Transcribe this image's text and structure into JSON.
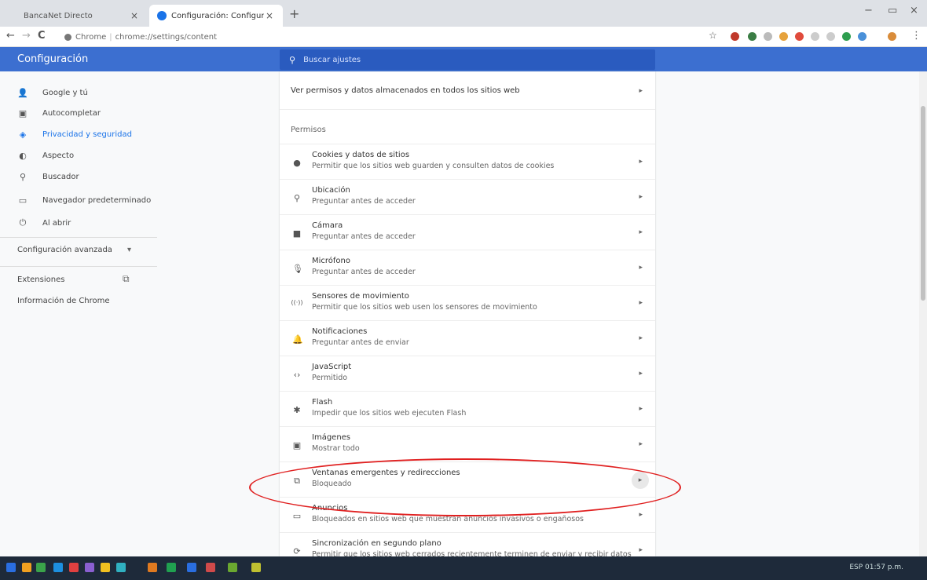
{
  "tabs": [
    {
      "title": "BancaNet Directo",
      "close": "×"
    },
    {
      "title": "Configuración: Configuración de",
      "close": "×"
    }
  ],
  "new_tab": "+",
  "window_controls": {
    "minimize": "−",
    "restore": "▭",
    "close": "×"
  },
  "address_bar": {
    "back": "←",
    "forward": "→",
    "reload": "C",
    "site_label": "Chrome",
    "separator": "|",
    "url": "chrome://settings/content",
    "bookmark_star": "☆",
    "menu": "⋮"
  },
  "header": {
    "title": "Configuración",
    "search_placeholder": "Buscar ajustes",
    "search_icon": "search-icon"
  },
  "sidebar": {
    "items": [
      {
        "label": "Google y tú",
        "icon": "person-icon",
        "glyph": "👤"
      },
      {
        "label": "Autocompletar",
        "icon": "clipboard-icon",
        "glyph": "▣"
      },
      {
        "label": "Privacidad y seguridad",
        "icon": "shield-icon",
        "glyph": "◈",
        "active": true
      },
      {
        "label": "Aspecto",
        "icon": "palette-icon",
        "glyph": "◐"
      },
      {
        "label": "Buscador",
        "icon": "search-icon",
        "glyph": "⚲"
      },
      {
        "label": "Navegador predeterminado",
        "icon": "browser-icon",
        "glyph": "▭"
      },
      {
        "label": "Al abrir",
        "icon": "power-icon",
        "glyph": "⏻"
      }
    ],
    "advanced": "Configuración avanzada",
    "advanced_chevron": "▾",
    "extensions": "Extensiones",
    "extensions_icon": "⧉",
    "about": "Información de Chrome"
  },
  "content": {
    "top_row": "Ver permisos y datos almacenados en todos los sitios web",
    "section": "Permisos",
    "arrow": "▸",
    "rows": [
      {
        "icon": "cookie-icon",
        "glyph": "●",
        "primary": "Cookies y datos de sitios",
        "secondary": "Permitir que los sitios web guarden y consulten datos de cookies"
      },
      {
        "icon": "location-icon",
        "glyph": "⚲",
        "primary": "Ubicación",
        "secondary": "Preguntar antes de acceder"
      },
      {
        "icon": "camera-icon",
        "glyph": "■",
        "primary": "Cámara",
        "secondary": "Preguntar antes de acceder"
      },
      {
        "icon": "microphone-icon",
        "glyph": "🎙",
        "primary": "Micrófono",
        "secondary": "Preguntar antes de acceder"
      },
      {
        "icon": "motion-sensor-icon",
        "glyph": "((·))",
        "primary": "Sensores de movimiento",
        "secondary": "Permitir que los sitios web usen los sensores de movimiento"
      },
      {
        "icon": "bell-icon",
        "glyph": "🔔",
        "primary": "Notificaciones",
        "secondary": "Preguntar antes de enviar"
      },
      {
        "icon": "code-icon",
        "glyph": "‹›",
        "primary": "JavaScript",
        "secondary": "Permitido"
      },
      {
        "icon": "puzzle-icon",
        "glyph": "✱",
        "primary": "Flash",
        "secondary": "Impedir que los sitios web ejecuten Flash"
      },
      {
        "icon": "image-icon",
        "glyph": "▣",
        "primary": "Imágenes",
        "secondary": "Mostrar todo"
      },
      {
        "icon": "popup-icon",
        "glyph": "⧉",
        "primary": "Ventanas emergentes y redirecciones",
        "secondary": "Bloqueado"
      },
      {
        "icon": "ads-icon",
        "glyph": "▭",
        "primary": "Anuncios",
        "secondary": "Bloqueados en sitios web que muestran anuncios invasivos o engañosos"
      },
      {
        "icon": "sync-icon",
        "glyph": "⟳",
        "primary": "Sincronización en segundo plano",
        "secondary": "Permitir que los sitios web cerrados recientemente terminen de enviar y recibir datos"
      }
    ]
  },
  "taskbar": {
    "tray_text": "ESP  01:57 p.m.",
    "colors": [
      "#2a6ee0",
      "#f0a020",
      "#3aa34a",
      "#1d8fe0",
      "#e04040",
      "#8a5fd0",
      "#f0c020",
      "#30b0c0",
      "#e07a20",
      "#20a050",
      "#2a6ee0",
      "#d04a4a",
      "#6aa830",
      "#c0c030"
    ]
  },
  "colors": {
    "header_bg": "#3c6fd0",
    "accent": "#1a73e8",
    "annotation": "#e02020"
  }
}
